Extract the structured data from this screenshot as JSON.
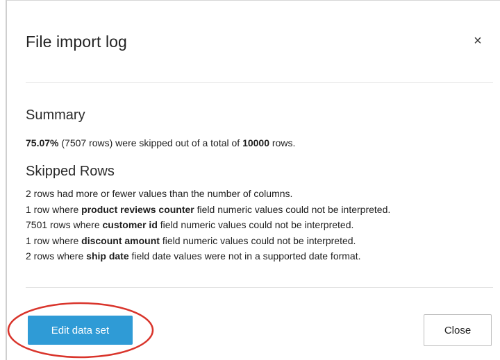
{
  "dialog": {
    "title": "File import log",
    "close_icon": "close-icon",
    "close_glyph": "×"
  },
  "summary": {
    "heading": "Summary",
    "percent": "75.07%",
    "rows_skipped_text": " (7507 rows) were skipped out of a total of ",
    "total": "10000",
    "suffix": " rows."
  },
  "skipped_rows": {
    "heading": "Skipped Rows",
    "line1": "2 rows had more or fewer values than the number of columns.",
    "line2": {
      "prefix": "1 row where ",
      "field": "product reviews counter",
      "suffix": " field numeric values could not be interpreted."
    },
    "line3": {
      "prefix": "7501 rows where ",
      "field": "customer id",
      "suffix": " field numeric values could not be interpreted."
    },
    "line4": {
      "prefix": "1 row where ",
      "field": "discount amount",
      "suffix": " field numeric values could not be interpreted."
    },
    "line5": {
      "prefix": "2 rows where ",
      "field": "ship date",
      "suffix": " field date values were not in a supported date format."
    }
  },
  "footer": {
    "edit_label": "Edit data set",
    "close_label": "Close"
  },
  "colors": {
    "primary_button": "#2f9bd6",
    "highlight_ellipse": "#d9342b"
  }
}
